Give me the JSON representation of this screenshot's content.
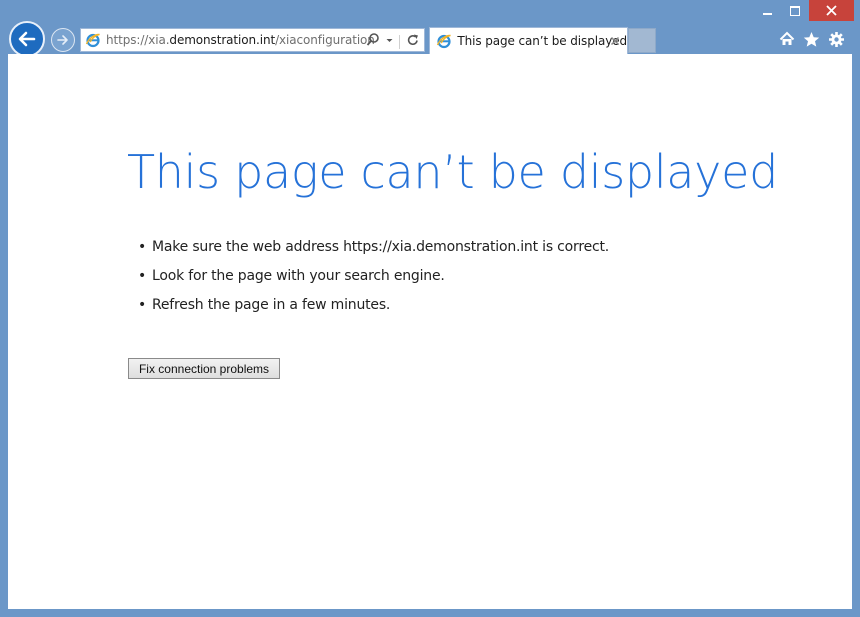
{
  "browser": {
    "address_bar": {
      "url_prefix": "https://xia.",
      "url_host": "demonstration.int",
      "url_path": "/xiaconfiguration"
    },
    "tab": {
      "title": "This page can’t be displayed"
    },
    "icons": {
      "back": "back-arrow-icon",
      "forward": "forward-arrow-icon",
      "favicon": "internet-explorer-icon",
      "search": "search-icon",
      "dropdown": "chevron-down-icon",
      "refresh": "refresh-icon",
      "tab_close": "close-icon",
      "home": "home-icon",
      "favorites": "star-icon",
      "tools": "gear-icon"
    },
    "colors": {
      "frame": "#6b97c8",
      "close_button": "#c7433b",
      "back_button": "#1e6bbf"
    }
  },
  "error_page": {
    "title": "This page can’t be displayed",
    "bullet_symbol": "•",
    "tips": [
      "Make sure the web address https://xia.demonstration.int is correct.",
      "Look for the page with your search engine.",
      "Refresh the page in a few minutes."
    ],
    "fix_button_label": "Fix connection problems",
    "title_color": "#2672d8"
  }
}
